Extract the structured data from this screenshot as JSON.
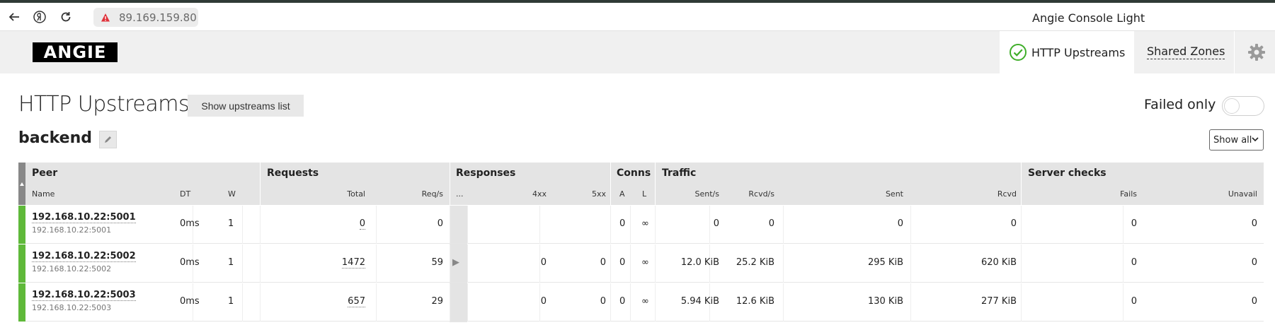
{
  "browser": {
    "url": "89.169.159.80",
    "tab_title": "Angie Console Light"
  },
  "app": {
    "logo": "ANGIE",
    "nav": {
      "upstreams": "HTTP Upstreams",
      "shared_zones": "Shared Zones"
    }
  },
  "page": {
    "title": "HTTP Upstreams",
    "show_list_button": "Show upstreams list",
    "failed_only_label": "Failed only",
    "failed_only_enabled": false,
    "group_name": "backend",
    "filter_selected": "Show all"
  },
  "table": {
    "groups": {
      "peer": "Peer",
      "requests": "Requests",
      "responses": "Responses",
      "conns": "Conns",
      "traffic": "Traffic",
      "checks": "Server checks"
    },
    "columns": {
      "name": "Name",
      "dt": "DT",
      "w": "W",
      "total": "Total",
      "reqs": "Req/s",
      "more": "...",
      "r4xx": "4xx",
      "r5xx": "5xx",
      "a": "A",
      "l": "L",
      "sent_s": "Sent/s",
      "rcvd_s": "Rcvd/s",
      "sent": "Sent",
      "rcvd": "Rcvd",
      "fails": "Fails",
      "unavail": "Unavail"
    },
    "rows": [
      {
        "name": "192.168.10.22:5001",
        "addr": "192.168.10.22:5001",
        "dt": "0ms",
        "w": "1",
        "total": "0",
        "reqs": "0",
        "expand": "",
        "r4xx": "",
        "r5xx": "",
        "a": "0",
        "l": "∞",
        "sent_s": "0",
        "rcvd_s": "0",
        "sent": "0",
        "rcvd": "0",
        "fails": "0",
        "unavail": "0"
      },
      {
        "name": "192.168.10.22:5002",
        "addr": "192.168.10.22:5002",
        "dt": "0ms",
        "w": "1",
        "total": "1472",
        "reqs": "59",
        "expand": "▶",
        "r4xx": "0",
        "r5xx": "0",
        "a": "0",
        "l": "∞",
        "sent_s": "12.0 KiB",
        "rcvd_s": "25.2 KiB",
        "sent": "295 KiB",
        "rcvd": "620 KiB",
        "fails": "0",
        "unavail": "0"
      },
      {
        "name": "192.168.10.22:5003",
        "addr": "192.168.10.22:5003",
        "dt": "0ms",
        "w": "1",
        "total": "657",
        "reqs": "29",
        "expand": "",
        "r4xx": "0",
        "r5xx": "0",
        "a": "0",
        "l": "∞",
        "sent_s": "5.94 KiB",
        "rcvd_s": "12.6 KiB",
        "sent": "130 KiB",
        "rcvd": "277 KiB",
        "fails": "0",
        "unavail": "0"
      }
    ]
  },
  "colors": {
    "peer_up": "#5fb93a",
    "header_bg": "#e4e4e4",
    "check_green": "#3fae2a",
    "warning_red": "#e0313a"
  }
}
